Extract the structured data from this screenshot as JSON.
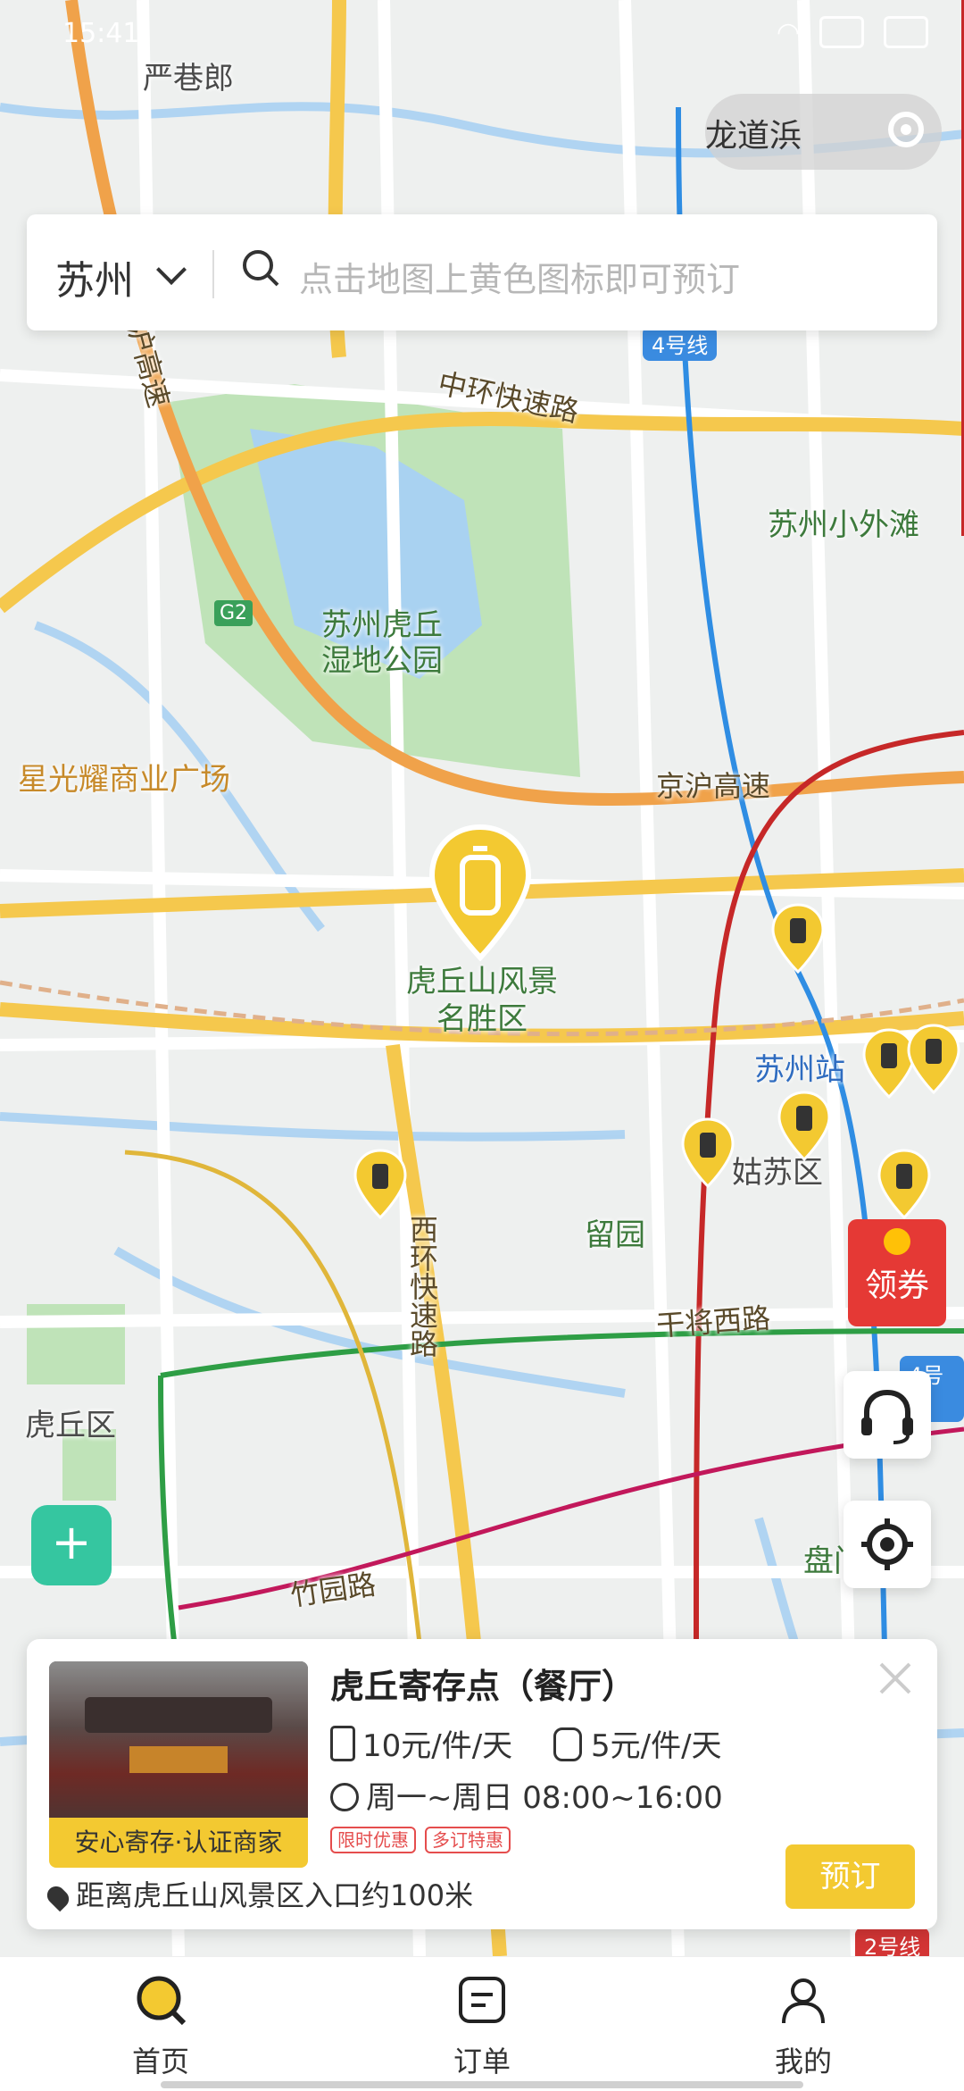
{
  "status_bar": {
    "time": "15:41"
  },
  "map": {
    "labels": {
      "poi_yanxianglang": "严巷郎",
      "poi_longdaobang": "龙道浜",
      "poi_waitan": "苏州小外滩",
      "park": "苏州虎丘\n湿地公园",
      "poi_xingguang": "星光耀商业广场",
      "scenic": "虎丘山风景\n名胜区",
      "station": "苏州站",
      "liuyuan": "留园",
      "district_gusu": "姑苏区",
      "district_huqiu": "虎丘区",
      "pan": "盘门",
      "road_zhonghuan": "中环快速路",
      "road_jinghu1": "京沪高速",
      "road_jinghu2": "京沪高速",
      "road_xihuan": "西环快速路",
      "road_ganjiang": "干将西路",
      "road_zhuyuan": "竹园路",
      "road_g2": "G2",
      "metro_4": "4号线",
      "metro_4b": "4号线",
      "metro_2": "2号线"
    }
  },
  "search": {
    "city": "苏州",
    "placeholder": "点击地图上黄色图标即可预订"
  },
  "coupon_label": "领券",
  "card": {
    "title": "虎丘寄存点（餐厅）",
    "price_large": "10元/件/天",
    "price_small": "5元/件/天",
    "hours": "周一~周日 08:00~16:00",
    "tags": [
      "限时优惠",
      "多订特惠"
    ],
    "badge": "安心寄存·认证商家",
    "distance": "距离虎丘山风景区入口约100米",
    "book_label": "预订"
  },
  "tabbar": {
    "home": "首页",
    "orders": "订单",
    "mine": "我的"
  },
  "colors": {
    "accent": "#f3c931",
    "pin": "#f3c931"
  }
}
